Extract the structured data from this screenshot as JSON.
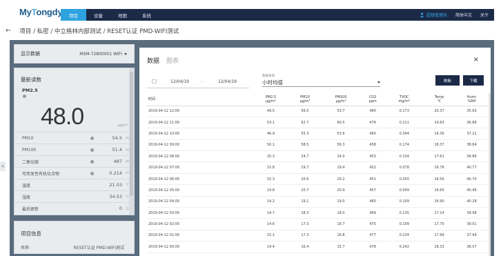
{
  "app": {
    "logo_prefix": "My",
    "logo_accent": "T",
    "logo_suffix": "ongdy"
  },
  "nav": {
    "tabs": [
      {
        "label": "项目",
        "active": true
      },
      {
        "label": "设备",
        "active": false
      },
      {
        "label": "地图",
        "active": false
      },
      {
        "label": "系统",
        "active": false
      }
    ],
    "user": "超级管理员",
    "language": "简体中文",
    "about": "关于"
  },
  "breadcrumb": "项目 / 私密 / 中立格林内部测试 / RESET认证 PMD-WIFI测试",
  "device_panel": {
    "label": "显示数据",
    "selected_device": "MSM-72800001 WIFI"
  },
  "latest": {
    "title": "最新读数",
    "main_metric": "PM2.5",
    "main_value": "48.0",
    "main_unit": "μg/m³",
    "metrics": [
      {
        "name": "PM10",
        "value": "54.5",
        "unit": "μg/m³",
        "dot": true
      },
      {
        "name": "PM100",
        "value": "51.4",
        "unit": "μg/m³",
        "dot": true
      },
      {
        "name": "二氧化碳",
        "value": "487",
        "unit": "ppm",
        "dot": true
      },
      {
        "name": "可挥发性有机化合物",
        "value": "0.214",
        "unit": "mg/m³",
        "dot": true
      },
      {
        "name": "温度",
        "value": "21.03",
        "unit": "℃",
        "dot": false
      },
      {
        "name": "湿度",
        "value": "34.53",
        "unit": "%RH",
        "dot": false
      },
      {
        "name": "最后更新",
        "value": "0",
        "unit": "分钟",
        "dot": false
      }
    ]
  },
  "project_info": {
    "title": "项目信息",
    "name_label": "名称",
    "name_value": "RESET认证 PMD-WIFI测试"
  },
  "side_tab": "<",
  "panel": {
    "tabs": [
      {
        "label": "数据",
        "active": true
      },
      {
        "label": "图表",
        "active": false
      }
    ],
    "close": "×",
    "date_from": "12/04/19",
    "date_sep": "-",
    "date_to": "12/04/19",
    "source_label": "数据来源",
    "source_value": "小时均值",
    "refresh_label": "刷新",
    "download_label": "下载"
  },
  "table": {
    "headers": [
      {
        "name": "时间",
        "unit": ""
      },
      {
        "name": "PM2.5",
        "unit": "μg/m³"
      },
      {
        "name": "PM10",
        "unit": "μg/m³"
      },
      {
        "name": "PM100",
        "unit": "μg/m³"
      },
      {
        "name": "CO2",
        "unit": "ppm"
      },
      {
        "name": "TVOC",
        "unit": "mg/m³"
      },
      {
        "name": "Temp",
        "unit": "℃"
      },
      {
        "name": "Humi",
        "unit": "%RH"
      }
    ],
    "rows": [
      [
        "2019-04-12 12:00",
        "49.5",
        "56.0",
        "53.7",
        "480",
        "0.173",
        "20.37",
        "35.93"
      ],
      [
        "2019-04-12 11:00",
        "53.1",
        "62.7",
        "60.5",
        "476",
        "0.211",
        "19.83",
        "36.88"
      ],
      [
        "2019-04-12 10:00",
        "46.9",
        "55.3",
        "53.6",
        "460",
        "0.394",
        "18.36",
        "37.21"
      ],
      [
        "2019-04-12 09:00",
        "50.1",
        "58.5",
        "56.3",
        "458",
        "0.174",
        "18.37",
        "38.64"
      ],
      [
        "2019-04-12 08:00",
        "20.3",
        "24.7",
        "24.0",
        "453",
        "0.104",
        "17.61",
        "38.86"
      ],
      [
        "2019-04-12 07:00",
        "15.8",
        "19.7",
        "19.4",
        "452",
        "0.078",
        "16.78",
        "40.77"
      ],
      [
        "2019-04-12 06:00",
        "15.3",
        "20.6",
        "20.2",
        "451",
        "0.050",
        "16.56",
        "40.70"
      ],
      [
        "2019-04-12 05:00",
        "14.8",
        "20.7",
        "20.9",
        "457",
        "0.049",
        "16.65",
        "40.46"
      ],
      [
        "2019-04-12 04:00",
        "14.2",
        "19.1",
        "19.0",
        "460",
        "0.109",
        "16.90",
        "40.28"
      ],
      [
        "2019-04-12 03:00",
        "14.7",
        "18.3",
        "18.0",
        "469",
        "0.135",
        "17.14",
        "39.98"
      ],
      [
        "2019-04-12 02:00",
        "14.6",
        "17.3",
        "16.7",
        "475",
        "0.199",
        "17.70",
        "39.01"
      ],
      [
        "2019-04-12 01:00",
        "15.1",
        "17.3",
        "16.8",
        "477",
        "0.234",
        "17.99",
        "37.99"
      ],
      [
        "2019-04-12 00:00",
        "14.4",
        "16.4",
        "15.7",
        "478",
        "0.242",
        "18.33",
        "38.57"
      ]
    ]
  },
  "colors": {
    "nav_bg": "#1b2a47",
    "nav_active": "#2ea3e0",
    "content_bg": "#5a6c7d",
    "panel_bg": "#e8ecef",
    "button_bg": "#1b2a47"
  }
}
